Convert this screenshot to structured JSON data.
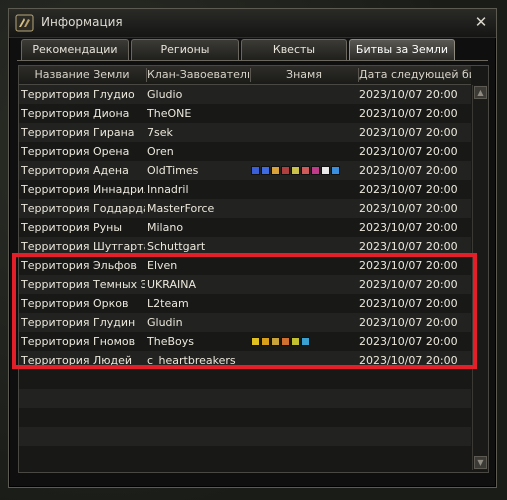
{
  "window": {
    "title": "Информация",
    "close_symbol": "✕"
  },
  "tabs": [
    {
      "label": "Рекомендации",
      "active": false
    },
    {
      "label": "Регионы",
      "active": false
    },
    {
      "label": "Квесты",
      "active": false
    },
    {
      "label": "Битвы за Земли",
      "active": true
    }
  ],
  "table": {
    "headers": [
      "Название Земли",
      "Клан-Завоеватель",
      "Знамя",
      "Дата следующей битвы"
    ],
    "rows": [
      {
        "name": "Территория Глудио",
        "clan": "Gludio",
        "flags": [],
        "date": "2023/10/07 20:00"
      },
      {
        "name": "Территория Диона",
        "clan": "TheONE",
        "flags": [],
        "date": "2023/10/07 20:00"
      },
      {
        "name": "Территория Гирана",
        "clan": "7sek",
        "flags": [],
        "date": "2023/10/07 20:00"
      },
      {
        "name": "Территория Орена",
        "clan": "Oren",
        "flags": [],
        "date": "2023/10/07 20:00"
      },
      {
        "name": "Территория Адена",
        "clan": "OldTimes",
        "flags": [
          "#3a5ed8",
          "#3f6be0",
          "#d9a13a",
          "#b04040",
          "#c9c14a",
          "#d05a5a",
          "#c03a8a",
          "#eaeaea",
          "#3a8ee0"
        ],
        "date": "2023/10/07 20:00"
      },
      {
        "name": "Территория Иннадрила",
        "clan": "Innadril",
        "flags": [],
        "date": "2023/10/07 20:00"
      },
      {
        "name": "Территория Годдарда",
        "clan": "MasterForce",
        "flags": [],
        "date": "2023/10/07 20:00"
      },
      {
        "name": "Территория Руны",
        "clan": "Milano",
        "flags": [],
        "date": "2023/10/07 20:00"
      },
      {
        "name": "Территория Шутгарта",
        "clan": "Schuttgart",
        "flags": [],
        "date": "2023/10/07 20:00"
      },
      {
        "name": "Территория Эльфов",
        "clan": "Elven",
        "flags": [],
        "date": "2023/10/07 20:00"
      },
      {
        "name": "Территория Темных Эл",
        "clan": "UKRAINA",
        "flags": [],
        "date": "2023/10/07 20:00"
      },
      {
        "name": "Территория Орков",
        "clan": "L2team",
        "flags": [],
        "date": "2023/10/07 20:00"
      },
      {
        "name": "Территория Глудин",
        "clan": "Gludin",
        "flags": [],
        "date": "2023/10/07 20:00"
      },
      {
        "name": "Территория Гномов",
        "clan": "TheBoys",
        "flags": [
          "#e0c020",
          "#d8a01a",
          "#c8a23a",
          "#d07030",
          "#c0c030",
          "#3aa0d0"
        ],
        "date": "2023/10/07 20:00"
      },
      {
        "name": "Территория Людей",
        "clan": "c_heartbreakers",
        "flags": [],
        "date": "2023/10/07 20:00"
      }
    ],
    "empty_rows": 5
  },
  "scrollbar": {
    "up_symbol": "▲",
    "down_symbol": "▼"
  },
  "colors": {
    "highlight": "#e3202a",
    "accent_tab": "#8e8a7f"
  }
}
